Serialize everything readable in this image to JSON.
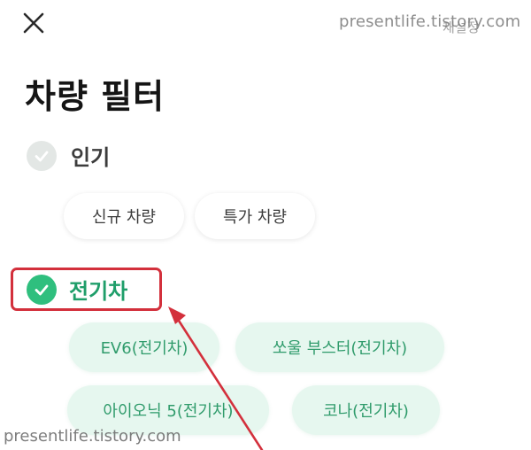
{
  "header": {
    "close_icon": "close-icon",
    "reset_label": "재설정",
    "title": "차량 필터"
  },
  "watermark": {
    "top": "presentlife.tistory.com",
    "bottom": "presentlife.tistory.com"
  },
  "sections": {
    "popular": {
      "label": "인기",
      "checked": false,
      "chips": [
        "신규 차량",
        "특가 차량"
      ]
    },
    "ev": {
      "label": "전기차",
      "checked": true,
      "chips": [
        "EV6(전기차)",
        "쏘울 부스터(전기차)",
        "아이오닉 5(전기차)",
        "코나(전기차)"
      ]
    }
  },
  "colors": {
    "accent_green": "#2fbf7e",
    "chip_green_bg": "#e6f7ef",
    "chip_green_text": "#2f9b6b",
    "highlight_red": "#d3303c",
    "unchecked_gray": "#e3e7e5"
  }
}
